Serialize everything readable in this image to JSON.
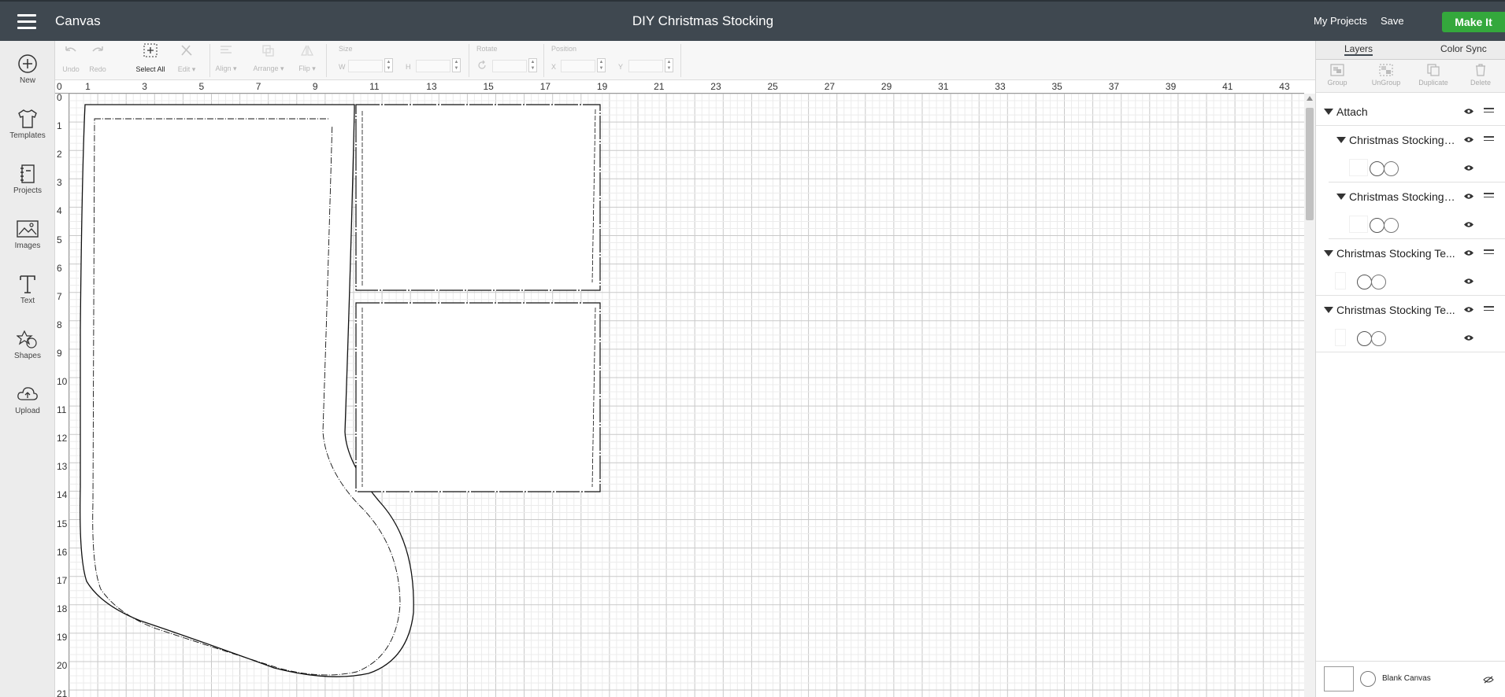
{
  "topbar": {
    "app_name": "Canvas",
    "project_title": "DIY Christmas Stocking",
    "my_projects": "My Projects",
    "save": "Save",
    "make_it": "Make It",
    "accent_color": "#34a83c",
    "bar_color": "#3f4850"
  },
  "sidebar": {
    "items": [
      {
        "label": "New",
        "icon": "plus-circle-icon"
      },
      {
        "label": "Templates",
        "icon": "tshirt-icon"
      },
      {
        "label": "Projects",
        "icon": "notebook-icon"
      },
      {
        "label": "Images",
        "icon": "image-icon"
      },
      {
        "label": "Text",
        "icon": "text-t-icon"
      },
      {
        "label": "Shapes",
        "icon": "shapes-icon"
      },
      {
        "label": "Upload",
        "icon": "cloud-upload-icon"
      }
    ]
  },
  "toolbar": {
    "undo": "Undo",
    "redo": "Redo",
    "select_all": "Select All",
    "edit": "Edit",
    "align": "Align",
    "arrange": "Arrange",
    "flip": "Flip",
    "size": "Size",
    "w": "W",
    "h": "H",
    "rotate": "Rotate",
    "position": "Position",
    "x": "X",
    "y": "Y"
  },
  "ruler": {
    "top": [
      "0",
      "1",
      "3",
      "5",
      "7",
      "9",
      "11",
      "13",
      "15",
      "17",
      "19",
      "21",
      "23",
      "25",
      "27",
      "29",
      "31",
      "33",
      "35",
      "37",
      "39",
      "41",
      "43"
    ],
    "left": [
      "0",
      "1",
      "2",
      "3",
      "4",
      "5",
      "6",
      "7",
      "8",
      "9",
      "10",
      "11",
      "12",
      "13",
      "14",
      "15",
      "16",
      "17",
      "18",
      "19",
      "20",
      "21"
    ]
  },
  "layers_panel": {
    "tabs": [
      "Layers",
      "Color Sync"
    ],
    "tools": [
      "Group",
      "UnGroup",
      "Duplicate",
      "Delete"
    ],
    "layers": [
      {
        "name": "Attach"
      },
      {
        "name": "Christmas Stocking ..."
      },
      {
        "name": "Christmas Stocking ..."
      },
      {
        "name": "Christmas Stocking Te..."
      },
      {
        "name": "Christmas Stocking Te..."
      }
    ],
    "blank_canvas": "Blank Canvas"
  }
}
